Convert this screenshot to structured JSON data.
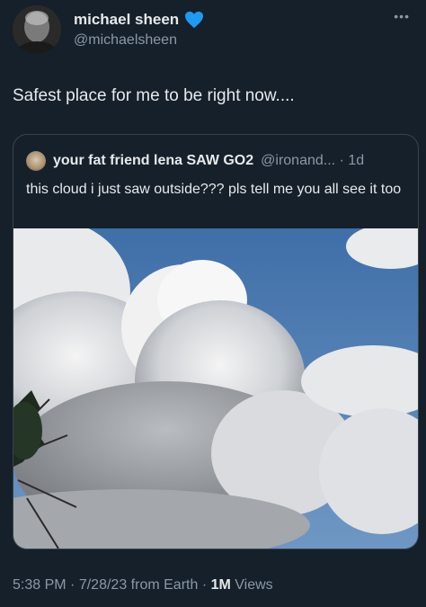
{
  "tweet": {
    "display_name": "michael sheen",
    "handle": "@michaelsheen",
    "text": "Safest place for me to be right now....",
    "verified_color": "#1d9bf0",
    "verified_icon": "blue-heart-icon"
  },
  "quoted_tweet": {
    "display_name": "your fat friend lena SAW GO2",
    "handle": "@ironand...",
    "separator": "·",
    "age": "1d",
    "text": "this cloud i just saw outside??? pls tell me you all see it too"
  },
  "metadata": {
    "time": "5:38 PM",
    "date": "7/28/23",
    "source": "from Earth",
    "views_count": "1M",
    "views_label": "Views",
    "separator": "·"
  },
  "colors": {
    "background": "#15202b",
    "text_primary": "#e7e9ea",
    "text_secondary": "#8b98a5",
    "border": "#38444d"
  }
}
